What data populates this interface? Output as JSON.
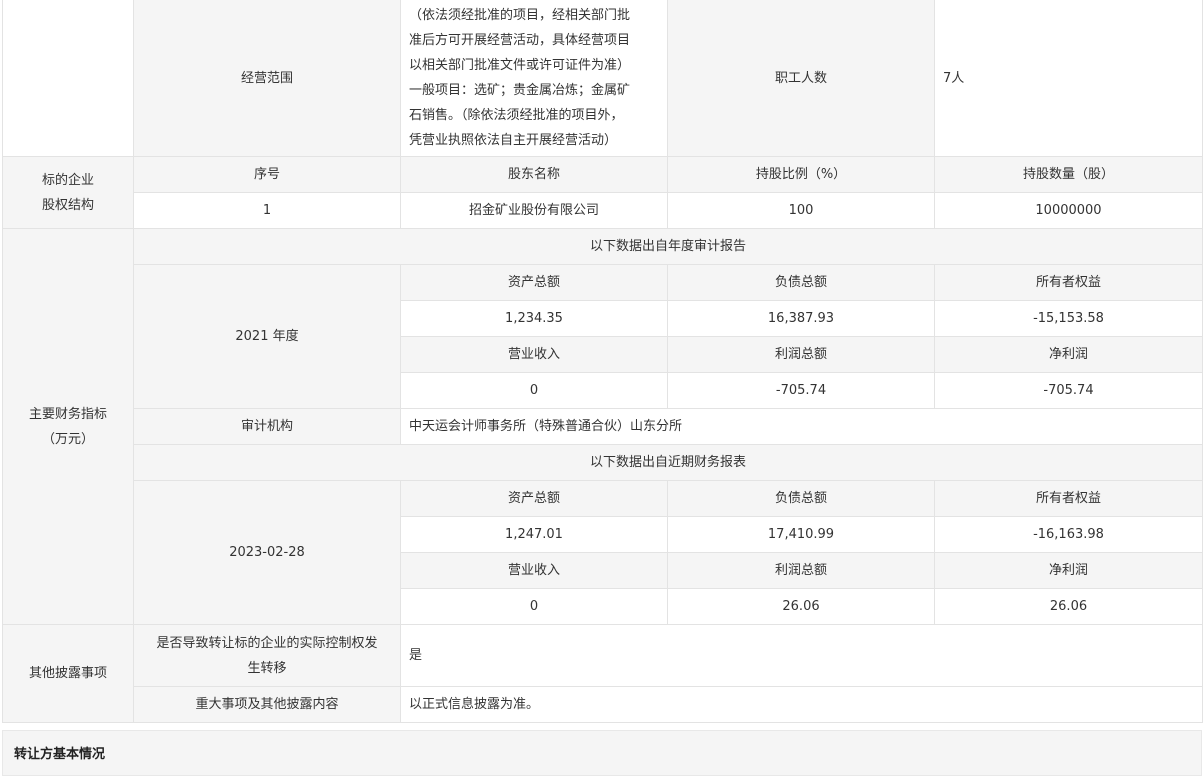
{
  "business": {
    "scope_label": "经营范围",
    "scope_lines": [
      "（依法须经批准的项目，经相关部门批",
      "准后方可开展经营活动，具体经营项目",
      "以相关部门批准文件或许可证件为准）",
      "一般项目：选矿；贵金属冶炼；金属矿",
      "石销售。（除依法须经批准的项目外，",
      "凭营业执照依法自主开展经营活动）"
    ],
    "employees_label": "职工人数",
    "employees_value": "7人"
  },
  "equity": {
    "label_line1": "标的企业",
    "label_line2": "股权结构",
    "headers": [
      "序号",
      "股东名称",
      "持股比例（%）",
      "持股数量（股）"
    ],
    "rows": [
      [
        "1",
        "招金矿业股份有限公司",
        "100",
        "10000000"
      ]
    ]
  },
  "finance": {
    "label_line1": "主要财务指标",
    "label_line2": "（万元）",
    "annual": {
      "source": "以下数据出自年度审计报告",
      "period": "2021 年度",
      "header1": [
        "资产总额",
        "负债总额",
        "所有者权益"
      ],
      "values1": [
        "1,234.35",
        "16,387.93",
        "-15,153.58"
      ],
      "header2": [
        "营业收入",
        "利润总额",
        "净利润"
      ],
      "values2": [
        "0",
        "-705.74",
        "-705.74"
      ]
    },
    "audit_label": "审计机构",
    "audit_value": "中天运会计师事务所（特殊普通合伙）山东分所",
    "recent": {
      "source": "以下数据出自近期财务报表",
      "period": "2023-02-28",
      "header1": [
        "资产总额",
        "负债总额",
        "所有者权益"
      ],
      "values1": [
        "1,247.01",
        "17,410.99",
        "-16,163.98"
      ],
      "header2": [
        "营业收入",
        "利润总额",
        "净利润"
      ],
      "values2": [
        "0",
        "26.06",
        "26.06"
      ]
    }
  },
  "other": {
    "label": "其他披露事项",
    "control_line1": "是否导致转让标的企业的实际控制权发",
    "control_line2": "生转移",
    "control_value": "是",
    "major_label": "重大事项及其他披露内容",
    "major_value": "以正式信息披露为准。"
  },
  "transferor": {
    "title": "转让方基本情况"
  }
}
